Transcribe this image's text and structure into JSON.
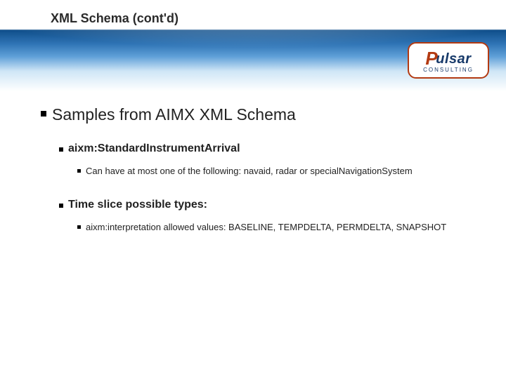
{
  "title": "XML Schema (cont'd)",
  "logo": {
    "brand": "ulsar",
    "swoosh": "P",
    "tagline": "CONSULTING"
  },
  "heading": "Samples from AIMX XML Schema",
  "sections": [
    {
      "label": "aixm:StandardInstrumentArrival",
      "items": [
        "Can have at most one of the following: navaid, radar or specialNavigationSystem"
      ]
    },
    {
      "label": "Time slice possible types:",
      "items": [
        "aixm:interpretation allowed values: BASELINE, TEMPDELTA, PERMDELTA, SNAPSHOT"
      ]
    }
  ]
}
